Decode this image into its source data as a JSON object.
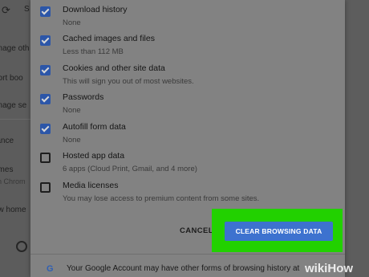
{
  "background_page": {
    "fragments": [
      "S",
      "anage oth",
      "port boo",
      "anage se",
      "rance",
      "emes",
      "en Chrom",
      "ow home"
    ]
  },
  "dialog": {
    "options": [
      {
        "label": "Download history",
        "detail": "None",
        "checked": true
      },
      {
        "label": "Cached images and files",
        "detail": "Less than 112 MB",
        "checked": true
      },
      {
        "label": "Cookies and other site data",
        "detail": "This will sign you out of most websites.",
        "checked": true
      },
      {
        "label": "Passwords",
        "detail": "None",
        "checked": true
      },
      {
        "label": "Autofill form data",
        "detail": "None",
        "checked": true
      },
      {
        "label": "Hosted app data",
        "detail": "6 apps (Cloud Print, Gmail, and 4 more)",
        "checked": false
      },
      {
        "label": "Media licenses",
        "detail": "You may lose access to premium content from some sites.",
        "checked": false
      }
    ],
    "cancel_label": "CANCEL",
    "clear_label": "CLEAR BROWSING DATA",
    "footer_text": "Your Google Account may have other forms of browsing history at",
    "highlight_color": "#22d100",
    "accent_color": "#3d72cf"
  },
  "watermark": {
    "prefix": "wiki",
    "suffix": "How"
  }
}
